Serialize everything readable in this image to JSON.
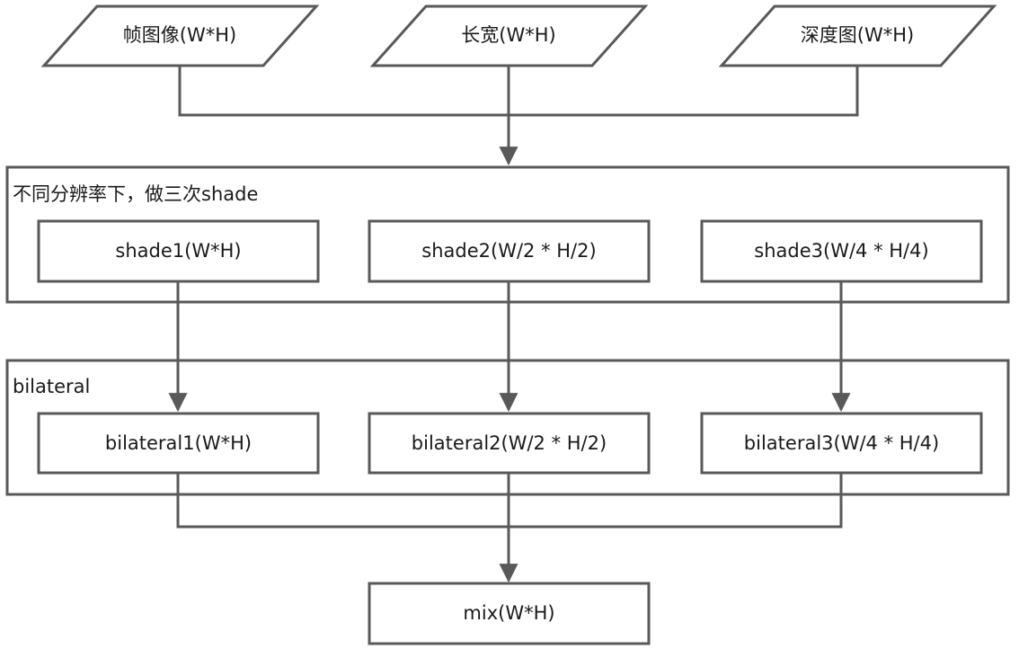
{
  "inputs": {
    "frame": "帧图像(W*H)",
    "size": "长宽(W*H)",
    "depth": "深度图(W*H)"
  },
  "shade_group": {
    "label": "不同分辨率下，做三次shade",
    "shade1": "shade1(W*H)",
    "shade2": "shade2(W/2 * H/2)",
    "shade3": "shade3(W/4 * H/4)"
  },
  "bilateral_group": {
    "label": "bilateral",
    "bilateral1": "bilateral1(W*H)",
    "bilateral2": "bilateral2(W/2 * H/2)",
    "bilateral3": "bilateral3(W/4 * H/4)"
  },
  "output": {
    "mix": "mix(W*H)"
  },
  "colors": {
    "stroke": "#595959",
    "text": "#1a1a1a",
    "background": "#ffffff"
  }
}
